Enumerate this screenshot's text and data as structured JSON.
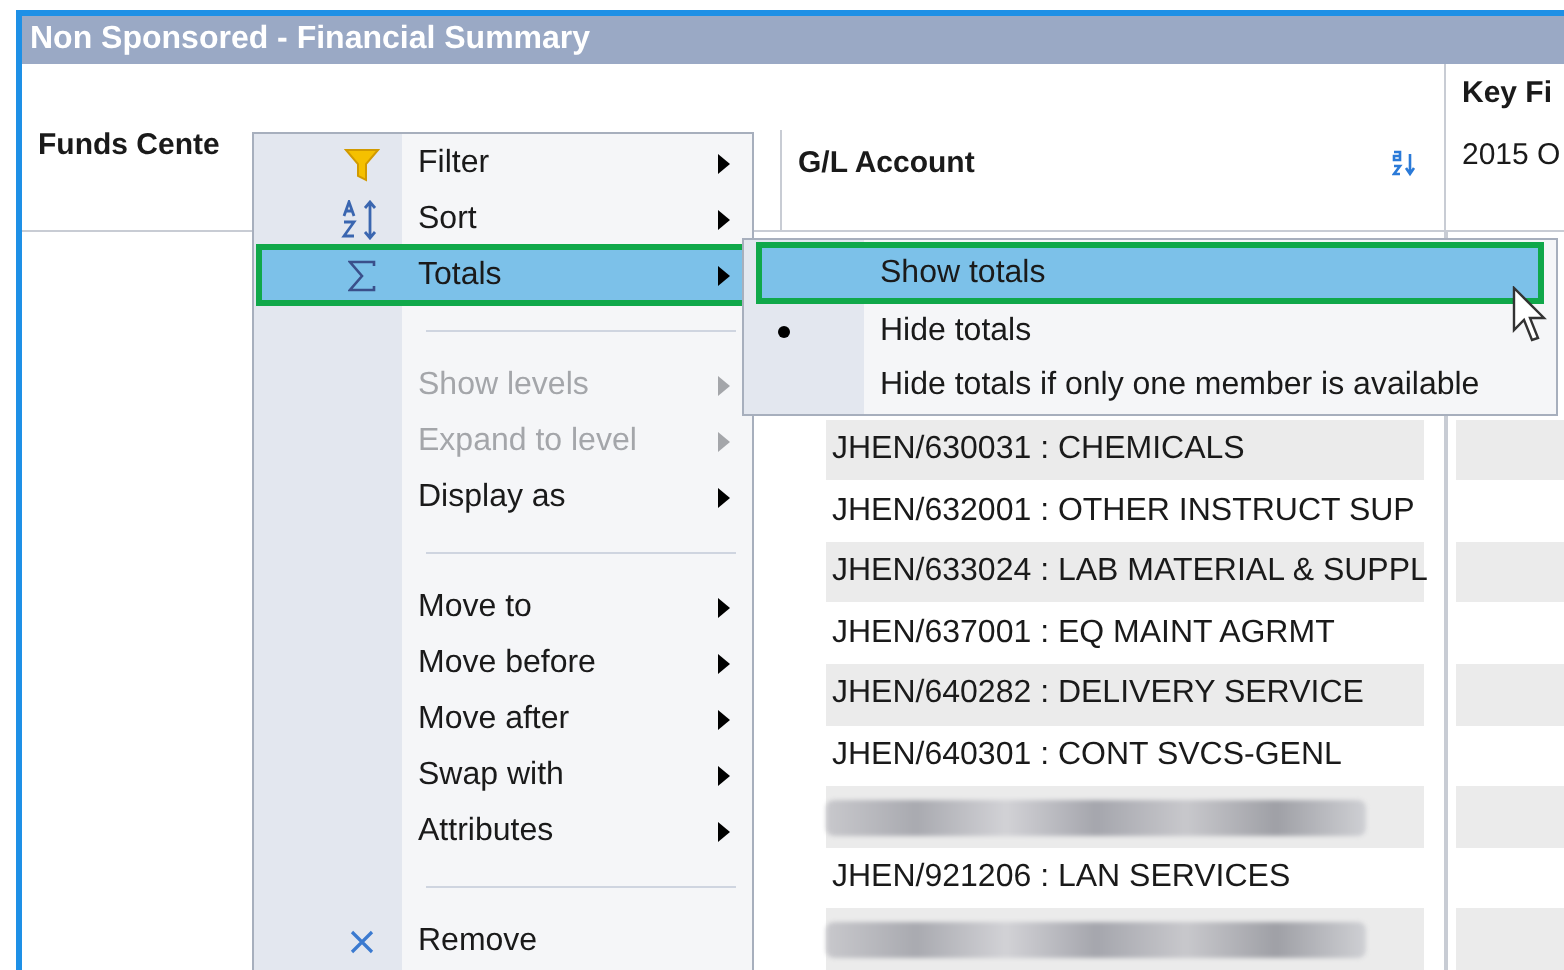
{
  "window": {
    "title": "Non Sponsored - Financial Summary"
  },
  "table": {
    "columns": [
      "Funds Cente",
      "G/L Account",
      "Key Fi"
    ],
    "key_figure_subheader": "2015 O",
    "rows": [
      {
        "kind": "text",
        "gl_account": "JHEN/630031 : CHEMICALS"
      },
      {
        "kind": "text",
        "gl_account": "JHEN/632001 : OTHER INSTRUCT SUP"
      },
      {
        "kind": "text",
        "gl_account": "JHEN/633024 : LAB MATERIAL & SUPPL"
      },
      {
        "kind": "text",
        "gl_account": "JHEN/637001 : EQ MAINT AGRMT"
      },
      {
        "kind": "text",
        "gl_account": "JHEN/640282 : DELIVERY SERVICE"
      },
      {
        "kind": "text",
        "gl_account": "JHEN/640301 : CONT SVCS-GENL"
      },
      {
        "kind": "redacted"
      },
      {
        "kind": "text",
        "gl_account": "JHEN/921206 : LAN SERVICES"
      },
      {
        "kind": "redacted"
      }
    ]
  },
  "context_menu": {
    "items": [
      {
        "kind": "item",
        "label": "Filter",
        "disabled": false,
        "highlighted": false,
        "submenu": true
      },
      {
        "kind": "item",
        "label": "Sort",
        "disabled": false,
        "highlighted": false,
        "submenu": true
      },
      {
        "kind": "item",
        "label": "Totals",
        "disabled": false,
        "highlighted": true,
        "submenu": true
      },
      {
        "kind": "separator"
      },
      {
        "kind": "item",
        "label": "Show levels",
        "disabled": true,
        "highlighted": false,
        "submenu": true
      },
      {
        "kind": "item",
        "label": "Expand to level",
        "disabled": true,
        "highlighted": false,
        "submenu": true
      },
      {
        "kind": "item",
        "label": "Display as",
        "disabled": false,
        "highlighted": false,
        "submenu": true
      },
      {
        "kind": "separator"
      },
      {
        "kind": "item",
        "label": "Move to",
        "disabled": false,
        "highlighted": false,
        "submenu": true
      },
      {
        "kind": "item",
        "label": "Move before",
        "disabled": false,
        "highlighted": false,
        "submenu": true
      },
      {
        "kind": "item",
        "label": "Move after",
        "disabled": false,
        "highlighted": false,
        "submenu": true
      },
      {
        "kind": "item",
        "label": "Swap with",
        "disabled": false,
        "highlighted": false,
        "submenu": true
      },
      {
        "kind": "item",
        "label": "Attributes",
        "disabled": false,
        "highlighted": false,
        "submenu": true
      },
      {
        "kind": "separator"
      },
      {
        "kind": "item",
        "label": "Remove",
        "disabled": false,
        "highlighted": false,
        "submenu": false
      }
    ]
  },
  "totals_submenu": {
    "items": [
      {
        "label": "Show totals",
        "highlighted": true,
        "selected": false
      },
      {
        "label": "Hide totals",
        "highlighted": false,
        "selected": true
      },
      {
        "label": "Hide totals if only one member is available",
        "highlighted": false,
        "selected": false
      }
    ]
  }
}
